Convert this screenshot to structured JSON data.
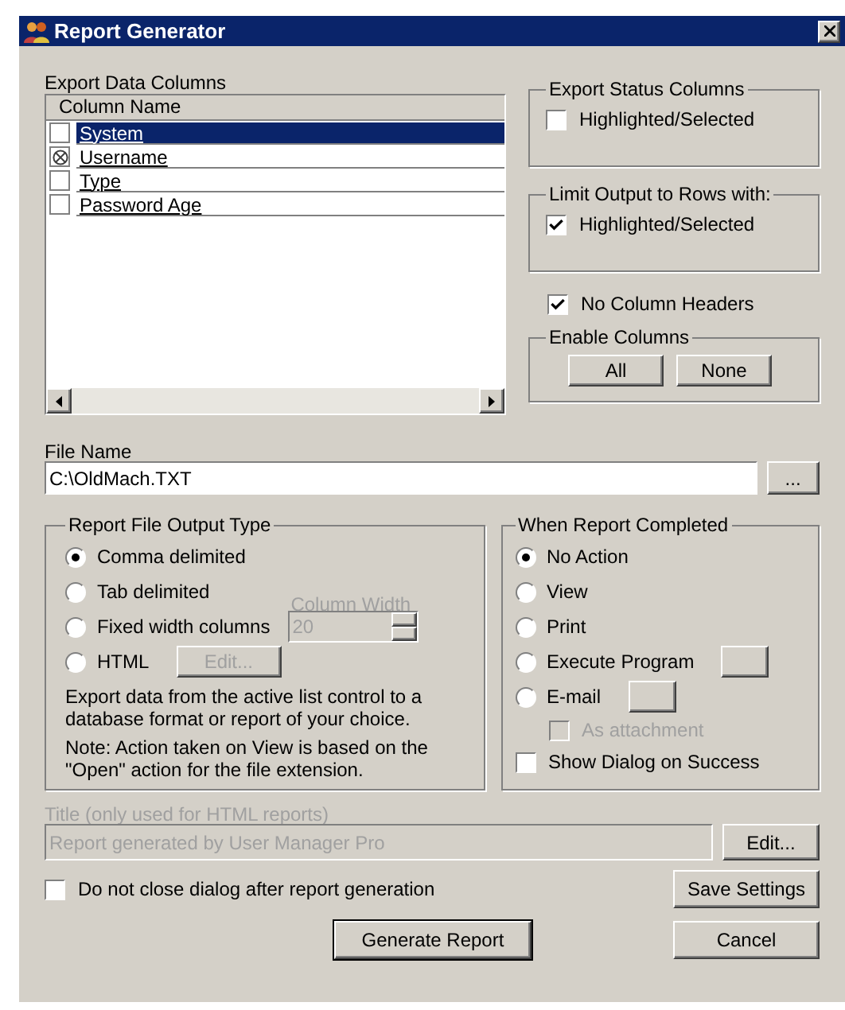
{
  "window": {
    "title": "Report Generator"
  },
  "export_columns": {
    "label": "Export Data Columns",
    "header": "Column Name",
    "rows": [
      {
        "name": "System",
        "checked": false,
        "selected": true
      },
      {
        "name": "Username",
        "checked": true,
        "selected": false
      },
      {
        "name": "Type",
        "checked": false,
        "selected": false
      },
      {
        "name": "Password Age",
        "checked": false,
        "selected": false
      }
    ]
  },
  "export_status": {
    "title": "Export Status Columns",
    "checkbox": {
      "label": "Highlighted/Selected",
      "checked": false
    }
  },
  "limit_output": {
    "title": "Limit Output to Rows with:",
    "checkbox": {
      "label": "Highlighted/Selected",
      "checked": true
    }
  },
  "no_column_headers": {
    "label": "No Column Headers",
    "checked": true
  },
  "enable_columns": {
    "title": "Enable Columns",
    "buttons": [
      "All",
      "None"
    ]
  },
  "file_name": {
    "label": "File Name",
    "value": "C:\\OldMach.TXT",
    "browse_button": "..."
  },
  "output_type": {
    "title": "Report File Output Type",
    "options": [
      {
        "label": "Comma delimited",
        "selected": true
      },
      {
        "label": "Tab delimited",
        "selected": false
      },
      {
        "label": "Fixed width columns",
        "selected": false
      },
      {
        "label": "HTML",
        "selected": false
      }
    ],
    "column_width": {
      "label": "Column Width",
      "value": "20",
      "disabled": true
    },
    "edit_button": {
      "label": "Edit...",
      "disabled": true
    },
    "notes": [
      "Export data from the active list control to a database format or report of your choice.",
      "Note: Action taken on View is based on the \"Open\" action for the file extension."
    ]
  },
  "when_completed": {
    "title": "When Report Completed",
    "options": [
      {
        "label": "No Action",
        "selected": true
      },
      {
        "label": "View",
        "selected": false
      },
      {
        "label": "Print",
        "selected": false
      },
      {
        "label": "Execute Program",
        "selected": false
      },
      {
        "label": "E-mail",
        "selected": false
      }
    ],
    "as_attachment": {
      "label": "As attachment",
      "checked": false,
      "disabled": true
    },
    "show_dialog": {
      "label": "Show Dialog on Success",
      "checked": false
    }
  },
  "html_title": {
    "label": "Title (only used for HTML reports)",
    "value": "Report generated by User Manager Pro",
    "disabled": true,
    "edit_button": "Edit..."
  },
  "do_not_close": {
    "label": "Do not close dialog after report generation",
    "checked": false
  },
  "buttons": {
    "save": "Save Settings",
    "generate": "Generate Report",
    "cancel": "Cancel"
  }
}
